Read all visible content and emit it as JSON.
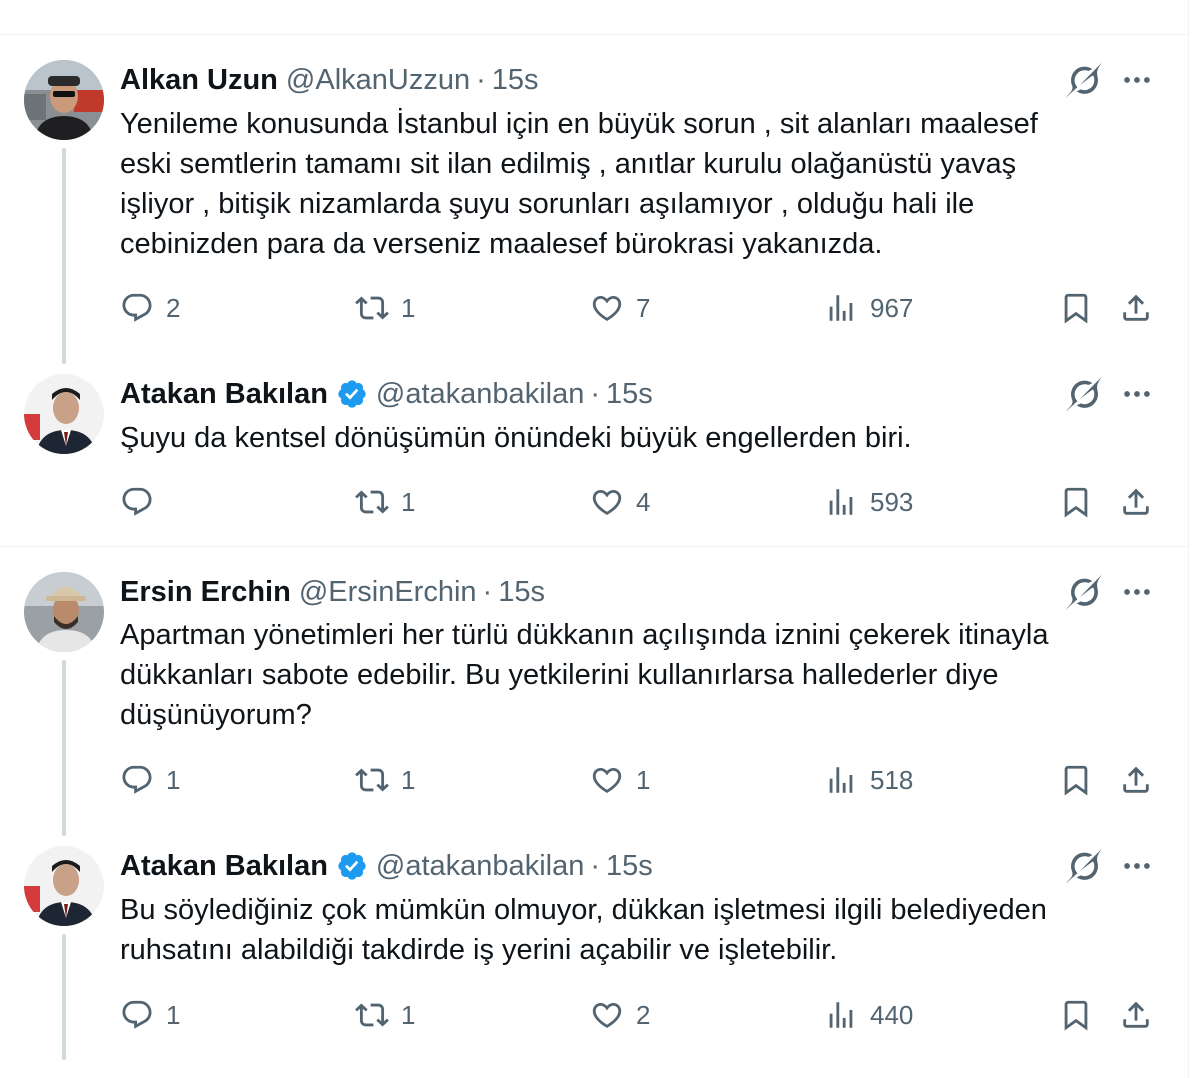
{
  "tweets": [
    {
      "name": "Alkan Uzun",
      "handle": "@AlkanUzzun",
      "separator": "·",
      "time": "15s",
      "verified": false,
      "avatar": "sunglasses-man-avatar",
      "text_lines": [
        "Yenileme konusunda İstanbul için en büyük sorun , sit alanları maalesef",
        "eski semtlerin tamamı sit ilan edilmiş , anıtlar kurulu olağanüstü yavaş",
        "işliyor , bitişik nizamlarda şuyu sorunları aşılamıyor , olduğu hali ile",
        "cebinizden para da verseniz maalesef bürokrasi yakanızda."
      ],
      "replies": "2",
      "reposts": "1",
      "likes": "7",
      "views": "967"
    },
    {
      "name": "Atakan Bakılan",
      "handle": "@atakanbakilan",
      "separator": "·",
      "time": "15s",
      "verified": true,
      "avatar": "suited-man-avatar",
      "text_lines": [
        "Şuyu da kentsel dönüşümün önündeki büyük engellerden biri."
      ],
      "replies": "",
      "reposts": "1",
      "likes": "4",
      "views": "593"
    },
    {
      "name": "Ersin Erchin",
      "handle": "@ErsinErchin",
      "separator": "·",
      "time": "15s",
      "verified": false,
      "avatar": "hat-man-avatar",
      "text_lines": [
        "Apartman yönetimleri her türlü dükkanın açılışında iznini çekerek itinayla",
        "dükkanları sabote edebilir. Bu yetkilerini kullanırlarsa hallederler diye",
        "düşünüyorum?"
      ],
      "replies": "1",
      "reposts": "1",
      "likes": "1",
      "views": "518"
    },
    {
      "name": "Atakan Bakılan",
      "handle": "@atakanbakilan",
      "separator": "·",
      "time": "15s",
      "verified": true,
      "avatar": "suited-man-avatar",
      "text_lines": [
        "Bu söylediğiniz çok mümkün olmuyor, dükkan işletmesi ilgili belediyeden",
        "ruhsatını alabildiği takdirde iş yerini açabilir ve işletebilir."
      ],
      "replies": "1",
      "reposts": "1",
      "likes": "2",
      "views": "440"
    }
  ],
  "icons": {
    "reply": "reply-icon",
    "repost": "repost-icon",
    "like": "heart-icon",
    "views": "views-icon",
    "bookmark": "bookmark-icon",
    "share": "share-icon",
    "grok": "grok-icon",
    "more": "more-icon",
    "verified": "verified-badge-icon"
  },
  "colors": {
    "text": "#0f1419",
    "secondary": "#536471",
    "verified": "#1d9bf0",
    "thread_line": "#cfd9de",
    "divider": "#eff3f4"
  }
}
